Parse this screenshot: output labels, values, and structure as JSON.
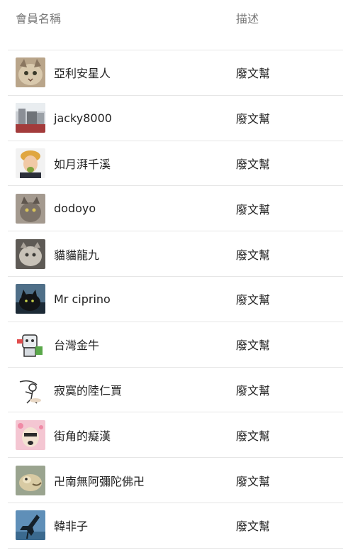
{
  "header": {
    "name_label": "會員名稱",
    "desc_label": "描述"
  },
  "members": [
    {
      "name": "亞利安星人",
      "desc": "廢文幫",
      "avatar": "cat-photo"
    },
    {
      "name": "jacky8000",
      "desc": "廢文幫",
      "avatar": "street-photo"
    },
    {
      "name": "如月湃千溪",
      "desc": "廢文幫",
      "avatar": "person-caricature"
    },
    {
      "name": "dodoyo",
      "desc": "廢文幫",
      "avatar": "cat-photo"
    },
    {
      "name": "貓貓龍九",
      "desc": "廢文幫",
      "avatar": "cat-photo"
    },
    {
      "name": "Mr ciprino",
      "desc": "廢文幫",
      "avatar": "black-cat-photo"
    },
    {
      "name": "台灣金牛",
      "desc": "廢文幫",
      "avatar": "robot-cartoon"
    },
    {
      "name": "寂寞的陸仁賈",
      "desc": "廢文幫",
      "avatar": "sketch-figure"
    },
    {
      "name": "街角的癡漢",
      "desc": "廢文幫",
      "avatar": "mask-cartoon"
    },
    {
      "name": "卍南無阿彌陀佛卍",
      "desc": "廢文幫",
      "avatar": "creature-photo"
    },
    {
      "name": "韓非子",
      "desc": "廢文幫",
      "avatar": "bird-silhouette"
    }
  ]
}
